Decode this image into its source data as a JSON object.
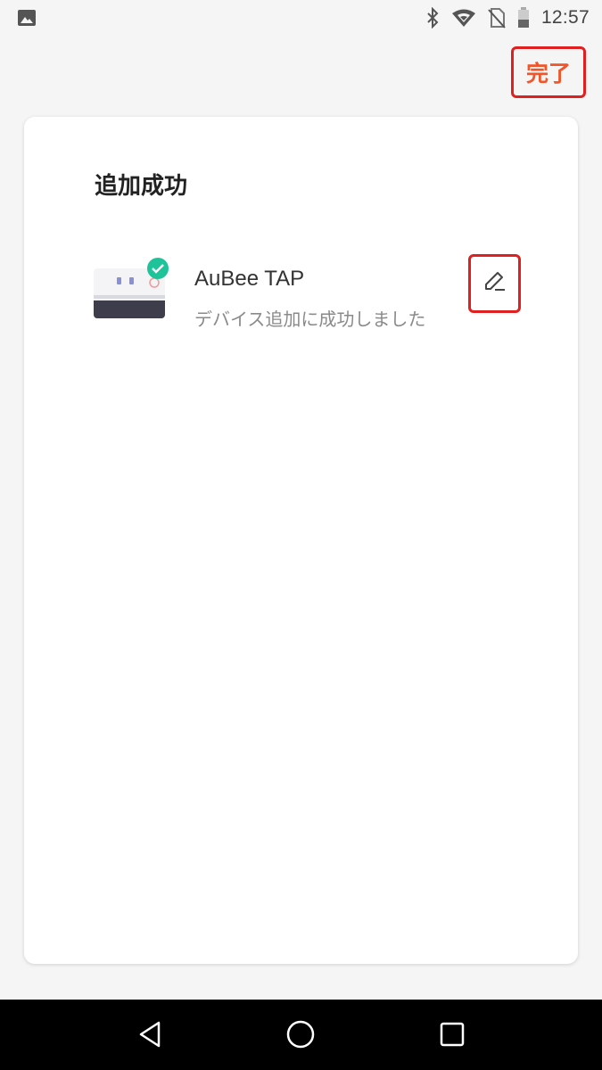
{
  "status_bar": {
    "time": "12:57",
    "icons": [
      "gallery-icon",
      "bluetooth-icon",
      "wifi-icon",
      "no-sim-icon",
      "battery-icon"
    ]
  },
  "header": {
    "done_label": "完了"
  },
  "card": {
    "title": "追加成功",
    "device": {
      "name": "AuBee TAP",
      "status": "デバイス追加に成功しました",
      "image_icon": "smart-plug-image",
      "badge_icon": "check-badge-icon",
      "edit_icon": "pencil-icon"
    }
  },
  "nav_bar": {
    "icons": [
      "back-icon",
      "home-icon",
      "recents-icon"
    ]
  },
  "colors": {
    "accent": "#f0562a",
    "highlight_border": "#e02020",
    "success_badge": "#1ec39a",
    "background": "#f5f5f5",
    "card": "#ffffff"
  }
}
